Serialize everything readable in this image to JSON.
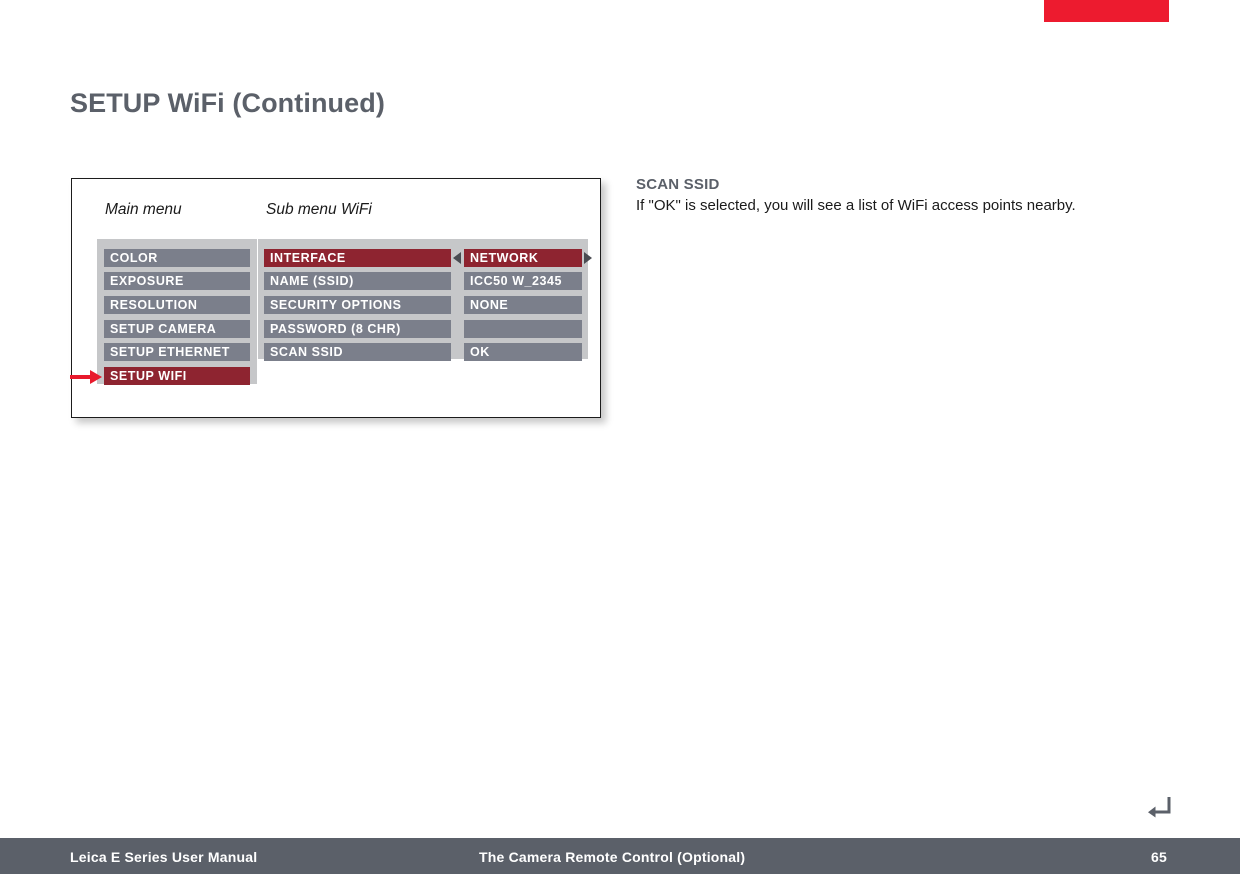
{
  "page": {
    "title": "SETUP WiFi (Continued)",
    "number": "65",
    "top_marker_color": "#ed1b2f",
    "title_color": "#5b6069"
  },
  "figure": {
    "captions": {
      "main_menu": "Main menu",
      "sub_menu": "Sub menu WiFi"
    },
    "main_menu": {
      "items": [
        {
          "label": "COLOR",
          "selected": false
        },
        {
          "label": "EXPOSURE",
          "selected": false
        },
        {
          "label": "RESOLUTION",
          "selected": false
        },
        {
          "label": "SETUP CAMERA",
          "selected": false
        },
        {
          "label": "SETUP ETHERNET",
          "selected": false
        },
        {
          "label": "SETUP WIFI",
          "selected": true
        }
      ]
    },
    "sub_menu": {
      "rows": [
        {
          "name": "INTERFACE",
          "value": "NETWORK",
          "selected": true,
          "has_arrows": true
        },
        {
          "name": "NAME (SSID)",
          "value": "ICC50 W_2345",
          "selected": false,
          "has_arrows": false
        },
        {
          "name": "SECURITY OPTIONS",
          "value": "NONE",
          "selected": false,
          "has_arrows": false
        },
        {
          "name": "PASSWORD (8 CHR)",
          "value": "",
          "selected": false,
          "has_arrows": false
        },
        {
          "name": "SCAN SSID",
          "value": "OK",
          "selected": false,
          "has_arrows": false
        }
      ]
    },
    "pointer": {
      "target": "SETUP WIFI",
      "color": "#e8192c"
    },
    "colors": {
      "panel_background": "#c6c7c9",
      "row_background": "#7b7f8b",
      "row_selected_background": "#8e2430",
      "row_text": "#ffffff",
      "arrow": "#4a4c52"
    }
  },
  "sidebar_note": {
    "heading": "SCAN SSID",
    "body": "If \"OK\" is selected, you will see a list of WiFi access points nearby."
  },
  "icons": {
    "return_arrow": "return-arrow-icon",
    "select_left": "triangle-left-icon",
    "select_right": "triangle-right-icon"
  },
  "footer": {
    "left": "Leica E Series User Manual",
    "center": "The Camera Remote Control (Optional)",
    "page": "65",
    "background": "#5b6069"
  }
}
